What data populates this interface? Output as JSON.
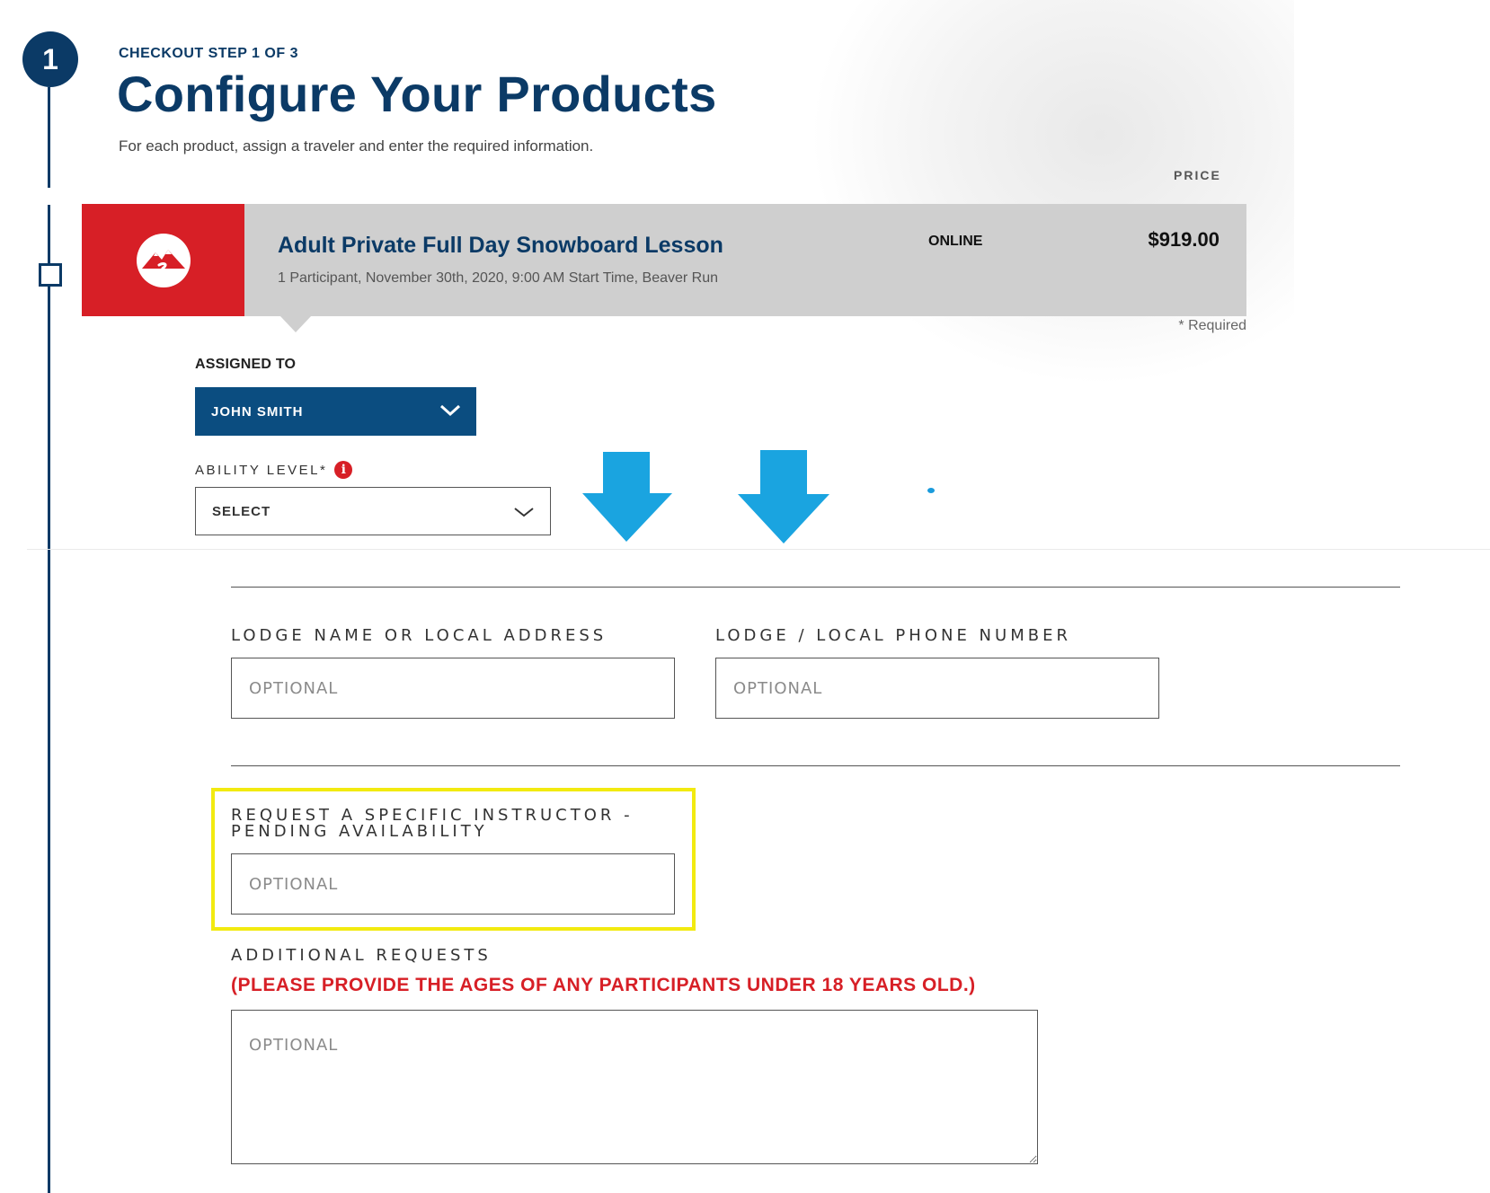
{
  "step": {
    "number": "1",
    "label": "CHECKOUT STEP 1 OF 3",
    "title": "Configure Your Products",
    "subtitle": "For each product, assign a traveler and enter the required information."
  },
  "table": {
    "price_header": "PRICE"
  },
  "product": {
    "name": "Adult Private Full Day Snowboard Lesson",
    "details": "1 Participant, November 30th, 2020, 9:00 AM Start Time, Beaver Run",
    "channel": "ONLINE",
    "price": "$919.00",
    "logo_icon": "mountain-logo-icon"
  },
  "form": {
    "required_note": "* Required",
    "assigned_label": "ASSIGNED TO",
    "assigned_value": "JOHN SMITH",
    "ability_label": "ABILITY LEVEL*",
    "ability_info_glyph": "i",
    "ability_value": "SELECT",
    "lodge_label": "LODGE NAME OR LOCAL ADDRESS",
    "lodge_placeholder": "OPTIONAL",
    "phone_label": "LODGE / LOCAL PHONE NUMBER",
    "phone_placeholder": "OPTIONAL",
    "instructor_label_line1": "REQUEST A SPECIFIC INSTRUCTOR -",
    "instructor_label_line2": "PENDING AVAILABILITY",
    "instructor_placeholder": "OPTIONAL",
    "additional_label": "ADDITIONAL REQUESTS",
    "additional_note": "(PLEASE PROVIDE THE AGES OF ANY PARTICIPANTS UNDER 18 YEARS OLD.)",
    "additional_placeholder": "OPTIONAL"
  },
  "colors": {
    "brand_navy": "#0b3a66",
    "select_blue": "#0b4d80",
    "brand_red": "#d71f26",
    "arrow_blue": "#1aa4e0",
    "highlight_yellow": "#f2ea10",
    "card_gray": "#cfcfcf"
  }
}
